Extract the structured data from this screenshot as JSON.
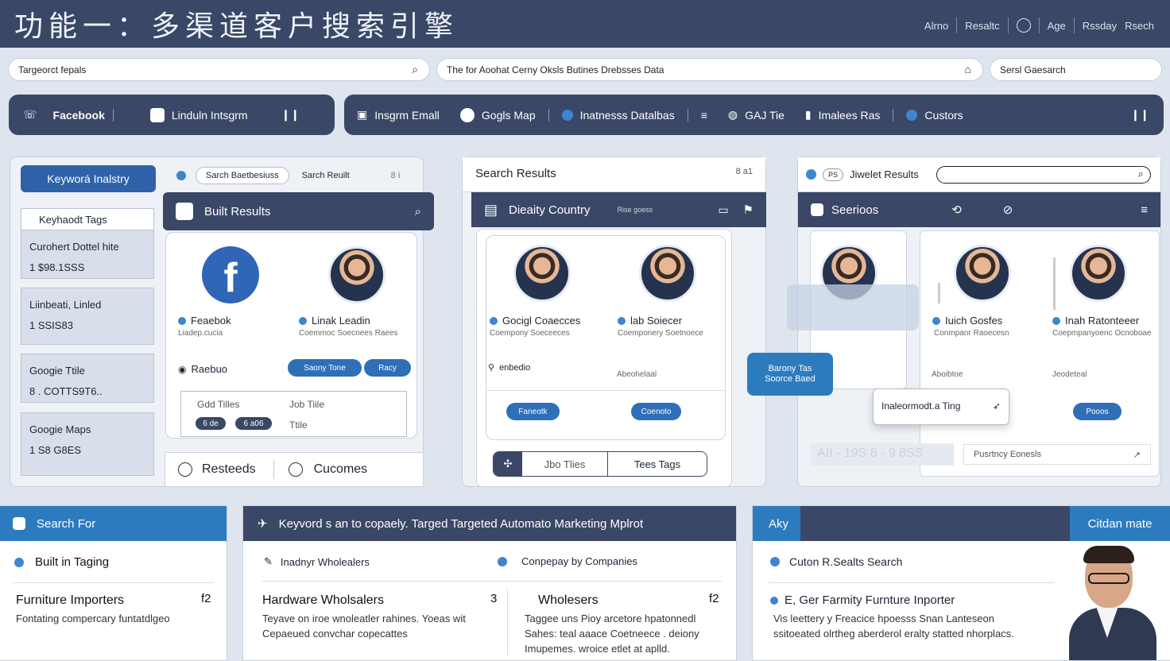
{
  "header": {
    "title": "功能一：多渠道客户搜索引擎",
    "nav": [
      "Alrno",
      "Resaltc",
      "Age",
      "Rssday",
      "Rsech"
    ]
  },
  "search": {
    "left": "Targeorct fepals",
    "mid": "The for Aoohat Cerny Oksls Butines Drebsses Data",
    "right": "Sersl Gaesarch"
  },
  "filters": {
    "left": [
      "Facebook",
      "Linduln Intsgrm"
    ],
    "right": [
      "Insgrm Emall",
      "Gogls Map",
      "Inatnesss Datalbas",
      "GAJ Tie",
      "Imalees Ras",
      "Custors"
    ]
  },
  "col1": {
    "keyword_btn": "Keyworá Inalstry",
    "tabs": [
      "Sarch Baetbesiuss",
      "Sarch Reuilt",
      "8 i"
    ],
    "tags_title": "Keyhaodt Tags",
    "side_items": [
      {
        "title": "Curohert Dottel hite",
        "value": "1 $98.1SSS"
      },
      {
        "title": "Liinbeati, Linled",
        "value": "1 SSIS83"
      },
      {
        "title": "Googie Ttile",
        "value": "8 . COTTS9T6.."
      },
      {
        "title": "Googie Maps",
        "value": "1 S8 G8ES"
      }
    ],
    "bar_title": "Built Results",
    "p1_name": "Feaebok",
    "p1_sub": "Liadep.cucia",
    "p2_name": "Linak Leadin",
    "p2_sub": "Coemmoc Soecnees Raees",
    "loc": "Raebuo",
    "chips": [
      "Saony Tone",
      "Racy"
    ],
    "box_a": "Gdd Tilles",
    "box_b": "Job Tiile",
    "box_c": "Ttile",
    "chip_a": "6 de",
    "chip_b": "6 a06",
    "btn_a": "Resteeds",
    "btn_b": "Cucomes"
  },
  "col2": {
    "title": "Search Results",
    "title_right": "8 a1",
    "bar_title": "Dieaity Country",
    "bar_badge": "Rise goess",
    "p1_name": "Gocigl Coaecces",
    "p1_sub": "Coempony Soeceeces",
    "p2_name": "lab Soiecer",
    "p2_sub": "Coemponery Soetnoece",
    "loc": "enbedio",
    "p2_foot": "Abeohelaal",
    "btn_a": "Faneotk",
    "btn_b": "Coenoto",
    "tab_a": "Jbo Tlies",
    "tab_b": "Tees Tags"
  },
  "col3": {
    "title": "Jiwelet Results",
    "title_badge": "PS",
    "bar_title": "Seerioos",
    "p1_name": "Iuich Gosfes",
    "p1_sub": "Conmpanr Raoecesn",
    "p2_name": "Inah Ratonteeer",
    "p2_sub": "Coepmpanyoenc Ocnoboae",
    "foot_a": "Aboibtoe",
    "foot_b": "Jeodeteal",
    "float_a": "Barony Tas Soorce Baed",
    "float_b": "Inaleormodt.a Ting",
    "btn": "Pooos",
    "footer_input": "Pusrtncy Eonesls",
    "dim_text": "AII - 19S 8 - 9 8SS"
  },
  "bottom": {
    "b1": {
      "head": "Search For",
      "item": "Built in Taging",
      "title": "Furniture Importers",
      "num": "f2",
      "desc": "Fontating compercary funtatdlgeo"
    },
    "b2": {
      "head": "Keyvord s an to copaely. Targed Targeted Automato Marketing Mplrot",
      "l1": "Inadnyr Wholealers",
      "l2": "Conpepay by Companies",
      "t1": "Hardware Wholsalers",
      "n1": "3",
      "d1": "Teyave on iroe wnoleatler rahines. Yoeas wit Cepaeued convchar copecattes",
      "t2": "Wholesers",
      "n2": "f2",
      "d2": "Taggee uns Pioy arcetore hpatonnedl Sahes: teal aaace Coetneece . deiony Imupemes. wroice etlet at aplld."
    },
    "b3": {
      "left": "Aky",
      "right": "Citdan mate",
      "item": "Cuton R.Sealts Search",
      "title": "E, Ger Farmity Furnture Inporter",
      "desc": "Vis leettery y Freacice hpoesss Snan Lanteseon ssitoeated olrtheg aberderol eralty statted nhorplacs."
    }
  },
  "colors": {
    "navy": "#3a4766",
    "blue": "#2f6fb8",
    "light": "#dfe5ee"
  }
}
